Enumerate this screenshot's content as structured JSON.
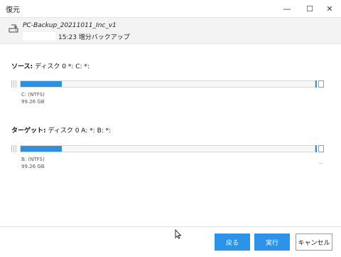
{
  "window": {
    "title": "復元",
    "controls": {
      "minimize": "—",
      "maximize": "☐",
      "close": "✕"
    }
  },
  "backup": {
    "name": "PC-Backup_20211011_Inc_v1",
    "time": "15:23 増分バックアップ",
    "icon": "drive-icon"
  },
  "source": {
    "label": "ソース:",
    "disk": "ディスク 0 *: C: *:",
    "partition_name": "C: (NTFS)",
    "size": "99.26 GB",
    "used_fraction": 0.14
  },
  "target": {
    "label": "ターゲット:",
    "disk": "ディスク 0 A: *: B: *:",
    "partition_name": "B: (NTFS)",
    "size": "99.26 GB",
    "used_fraction": 0.14,
    "more": "..."
  },
  "buttons": {
    "back": "戻る",
    "execute": "実行",
    "cancel": "キャンセル"
  },
  "colors": {
    "accent": "#2c8fe0",
    "button_primary": "#2c93e8",
    "header_band": "#f3f3f3"
  }
}
